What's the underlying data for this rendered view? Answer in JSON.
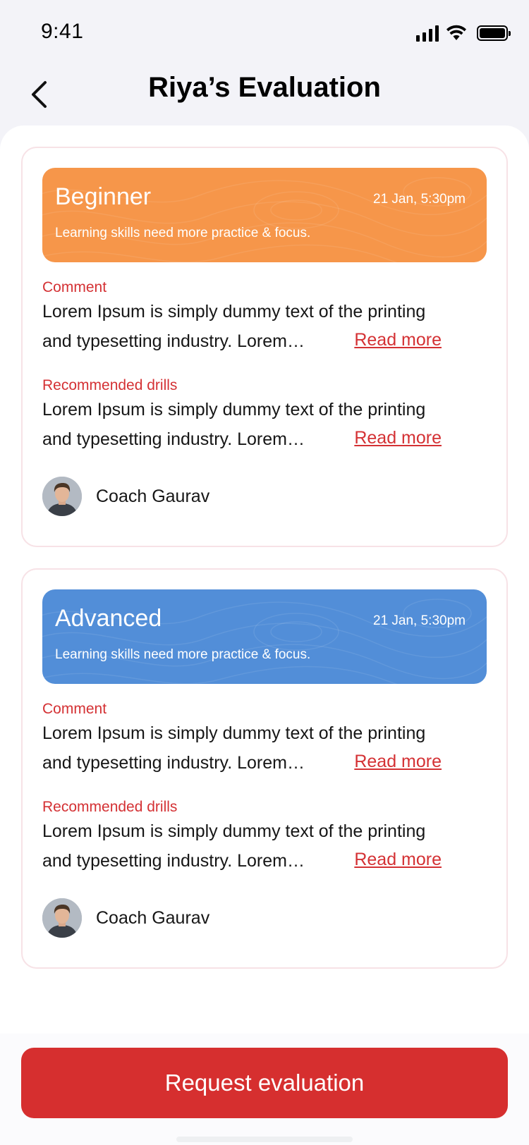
{
  "status_bar": {
    "time": "9:41"
  },
  "header": {
    "title": "Riya’s Evaluation",
    "back_icon": "chevron-left-icon"
  },
  "colors": {
    "accent": "#d62f2f",
    "beginner": "#f6964a",
    "advanced": "#528ed8"
  },
  "evaluations": [
    {
      "level": "Beginner",
      "date": "21 Jan, 5:30pm",
      "description": "Learning skills need more practice & focus.",
      "comment_label": "Comment",
      "comment_line1": "Lorem Ipsum is simply dummy text of the printing",
      "comment_line2": "and typesetting industry. Lorem…",
      "drills_label": "Recommended drills",
      "drills_line1": "Lorem Ipsum is simply dummy text of the printing",
      "drills_line2": "and typesetting industry. Lorem…",
      "read_more": "Read more",
      "coach": "Coach Gaurav"
    },
    {
      "level": "Advanced",
      "date": "21 Jan, 5:30pm",
      "description": "Learning skills need more practice & focus.",
      "comment_label": "Comment",
      "comment_line1": "Lorem Ipsum is simply dummy text of the printing",
      "comment_line2": "and typesetting industry. Lorem…",
      "drills_label": "Recommended drills",
      "drills_line1": "Lorem Ipsum is simply dummy text of the printing",
      "drills_line2": "and typesetting industry. Lorem…",
      "read_more": "Read more",
      "coach": "Coach Gaurav"
    }
  ],
  "footer": {
    "button_label": "Request evaluation"
  }
}
